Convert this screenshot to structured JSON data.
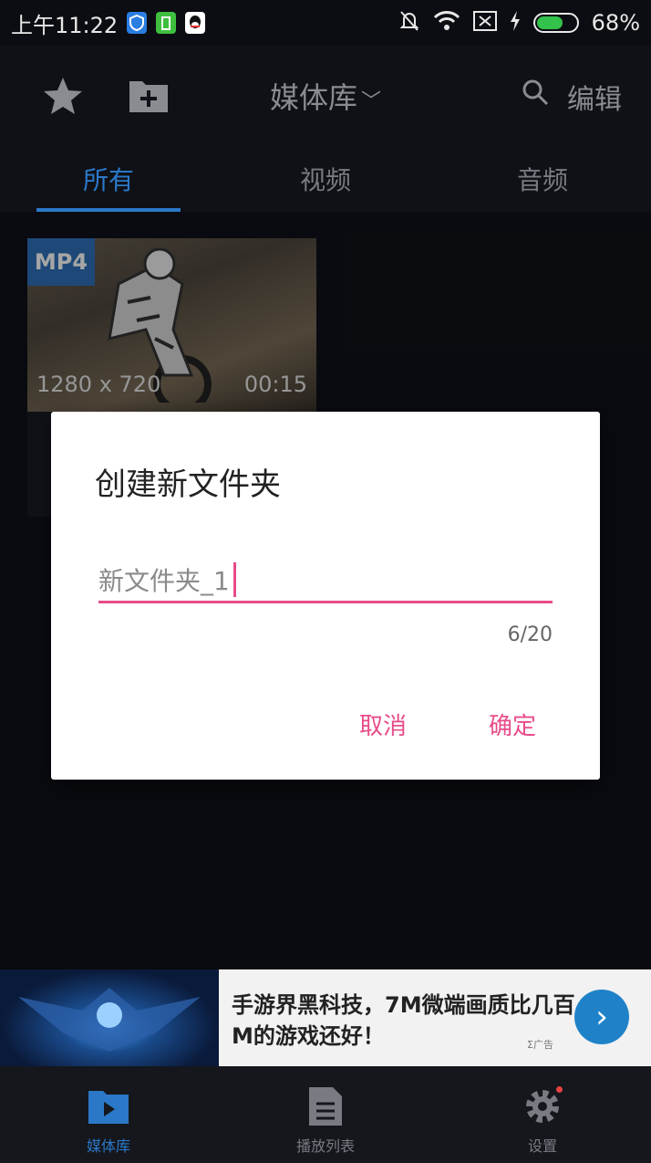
{
  "status_bar": {
    "time": "上午11:22",
    "battery_percent": "68%",
    "battery_level": 0.68
  },
  "app_bar": {
    "title": "媒体库",
    "edit_label": "编辑"
  },
  "tabs": [
    {
      "label": "所有",
      "active": true
    },
    {
      "label": "视频",
      "active": false
    },
    {
      "label": "音频",
      "active": false
    }
  ],
  "media_card": {
    "format_badge": "MP4",
    "resolution": "1280 x 720",
    "duration": "00:15"
  },
  "dialog": {
    "title": "创建新文件夹",
    "input_value": "新文件夹_1",
    "counter": "6/20",
    "cancel_label": "取消",
    "confirm_label": "确定"
  },
  "ad_banner": {
    "text": "手游界黑科技，7M微端画质比几百M的游戏还好！",
    "tag": "Σ广告"
  },
  "bottom_nav": [
    {
      "label": "媒体库",
      "icon": "media-library-icon",
      "active": true
    },
    {
      "label": "播放列表",
      "icon": "playlist-icon",
      "active": false
    },
    {
      "label": "设置",
      "icon": "settings-gear-icon",
      "active": false
    }
  ],
  "colors": {
    "accent_blue": "#2b78c8",
    "accent_pink": "#e84c8a",
    "background": "#101219"
  }
}
